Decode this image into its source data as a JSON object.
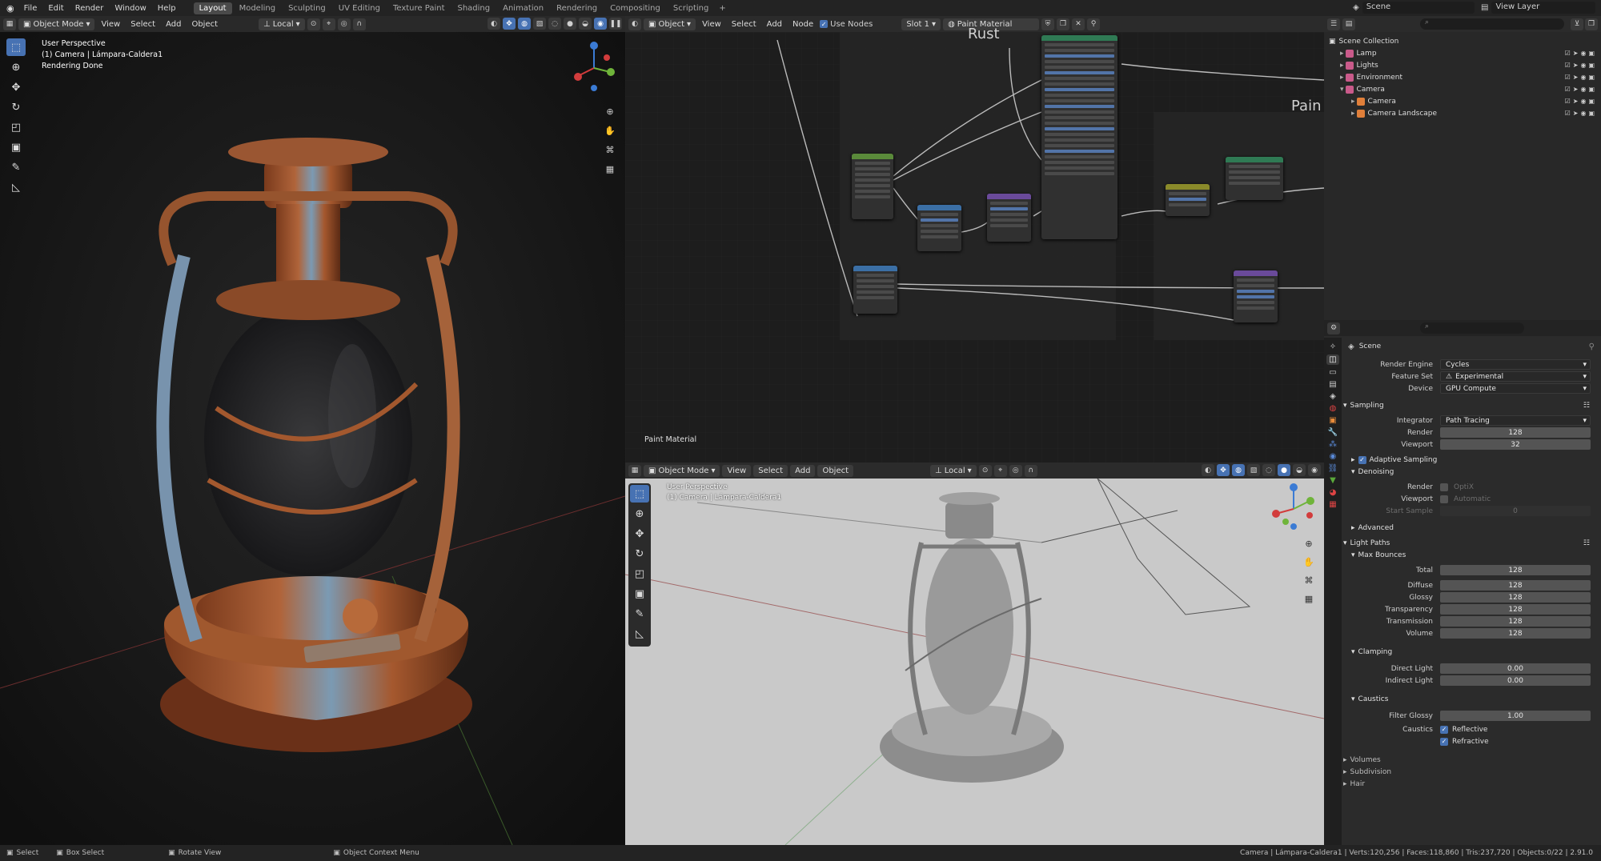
{
  "topbar": {
    "menus": [
      "File",
      "Edit",
      "Render",
      "Window",
      "Help"
    ],
    "workspaces": [
      "Layout",
      "Modeling",
      "Sculpting",
      "UV Editing",
      "Texture Paint",
      "Shading",
      "Animation",
      "Rendering",
      "Compositing",
      "Scripting"
    ],
    "active_workspace": "Layout",
    "scene": "Scene",
    "view_layer": "View Layer"
  },
  "viewport_left": {
    "mode": "Object Mode",
    "menus": [
      "View",
      "Select",
      "Add",
      "Object"
    ],
    "orientation": "Local",
    "overlay_lines": [
      "User Perspective",
      "(1) Camera | Lámpara-Caldera1",
      "Rendering Done"
    ]
  },
  "node_editor": {
    "type_label": "Object",
    "menus": [
      "View",
      "Select",
      "Add",
      "Node"
    ],
    "use_nodes": "Use Nodes",
    "slot": "Slot 1",
    "material": "Paint Material",
    "frame_labels": [
      "Rust",
      "Pain"
    ],
    "footer_label": "Paint Material"
  },
  "viewport_bottom": {
    "mode": "Object Mode",
    "menus": [
      "View",
      "Select",
      "Add",
      "Object"
    ],
    "orientation": "Local",
    "overlay_lines": [
      "User Perspective",
      "(1) Camera | Lámpara-Caldera1"
    ]
  },
  "outliner": {
    "root": "Scene Collection",
    "items": [
      {
        "label": "Lamp",
        "color": "#c95a8a",
        "depth": 1
      },
      {
        "label": "Lights",
        "color": "#c95a8a",
        "depth": 1
      },
      {
        "label": "Environment",
        "color": "#c95a8a",
        "depth": 1
      },
      {
        "label": "Camera",
        "color": "#c95a8a",
        "depth": 1
      },
      {
        "label": "Camera",
        "color": "#e07f3a",
        "depth": 2
      },
      {
        "label": "Camera Landscape",
        "color": "#e07f3a",
        "depth": 2
      }
    ]
  },
  "properties": {
    "scene_label": "Scene",
    "render_engine": {
      "label": "Render Engine",
      "value": "Cycles"
    },
    "feature_set": {
      "label": "Feature Set",
      "value": "Experimental"
    },
    "device": {
      "label": "Device",
      "value": "GPU Compute"
    },
    "sampling": {
      "title": "Sampling",
      "integrator": {
        "label": "Integrator",
        "value": "Path Tracing"
      },
      "render": {
        "label": "Render",
        "value": "128"
      },
      "viewport": {
        "label": "Viewport",
        "value": "32"
      },
      "adaptive": "Adaptive Sampling",
      "denoising": "Denoising",
      "den_render": {
        "label": "Render",
        "value": "OptiX"
      },
      "den_viewport": {
        "label": "Viewport",
        "value": "Automatic"
      },
      "start_sample": {
        "label": "Start Sample",
        "value": "0"
      },
      "advanced": "Advanced"
    },
    "light_paths": {
      "title": "Light Paths",
      "max_bounces": "Max Bounces",
      "total": {
        "label": "Total",
        "value": "128"
      },
      "diffuse": {
        "label": "Diffuse",
        "value": "128"
      },
      "glossy": {
        "label": "Glossy",
        "value": "128"
      },
      "transparency": {
        "label": "Transparency",
        "value": "128"
      },
      "transmission": {
        "label": "Transmission",
        "value": "128"
      },
      "volume": {
        "label": "Volume",
        "value": "128"
      },
      "clamping": "Clamping",
      "direct": {
        "label": "Direct Light",
        "value": "0.00"
      },
      "indirect": {
        "label": "Indirect Light",
        "value": "0.00"
      },
      "caustics": "Caustics",
      "filter_glossy": {
        "label": "Filter Glossy",
        "value": "1.00"
      },
      "caustics_label": "Caustics",
      "reflective": "Reflective",
      "refractive": "Refractive"
    },
    "collapsed": [
      "Volumes",
      "Subdivision",
      "Hair"
    ]
  },
  "statusbar": {
    "items": [
      "Select",
      "Box Select",
      "Rotate View",
      "Object Context Menu"
    ],
    "stats": "Camera | Lámpara-Caldera1 | Verts:120,256 | Faces:118,860 | Tris:237,720 | Objects:0/22 | 2.91.0"
  }
}
